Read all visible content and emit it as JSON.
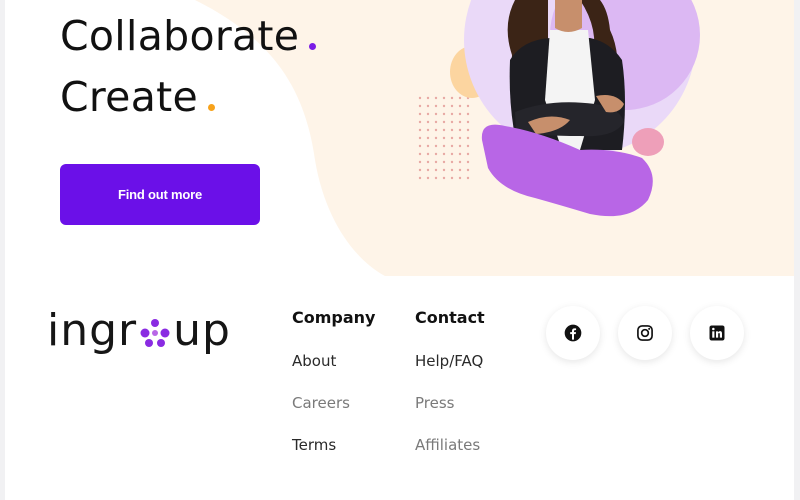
{
  "hero": {
    "line1": "Collaborate",
    "line2": "Create",
    "cta_label": "Find out more"
  },
  "footer": {
    "logo_text_left": "ingr",
    "logo_text_right": "up",
    "columns": [
      {
        "title": "Company",
        "links": [
          "About",
          "Careers",
          "Terms"
        ]
      },
      {
        "title": "Contact",
        "links": [
          "Help/FAQ",
          "Press",
          "Affiliates"
        ]
      }
    ],
    "social": [
      "facebook-icon",
      "instagram-icon",
      "linkedin-icon"
    ]
  },
  "colors": {
    "primary": "#6b10e8",
    "accent_orange": "#f7a21b",
    "hero_bg": "#fef4e8",
    "blob_purple": "#b866e6"
  }
}
